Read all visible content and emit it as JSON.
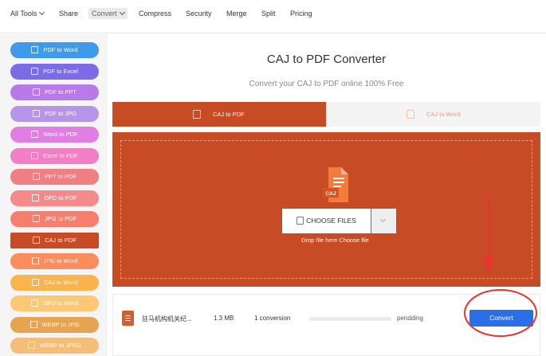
{
  "nav": {
    "all_tools": "All Tools",
    "items": [
      "Share",
      "Convert",
      "Compress",
      "Security",
      "Merge",
      "Split",
      "Pricing"
    ]
  },
  "sidebar": {
    "items": [
      {
        "label": "PDF to Word",
        "color": "#3d9be9"
      },
      {
        "label": "PDF to Excel",
        "color": "#7c6be6"
      },
      {
        "label": "PDF to PPT",
        "color": "#b77ae6"
      },
      {
        "label": "PDF to JPG",
        "color": "#b694e8"
      },
      {
        "label": "Word to PDF",
        "color": "#e07ee3"
      },
      {
        "label": "Excel to PDF",
        "color": "#f07fc4"
      },
      {
        "label": "PPT to PDF",
        "color": "#f07f84"
      },
      {
        "label": "OFD to PDF",
        "color": "#f58a8a"
      },
      {
        "label": "JPG to PDF",
        "color": "#f77d6c"
      },
      {
        "label": "CAJ to PDF",
        "color": "#c74b24"
      },
      {
        "label": "JPG to Word",
        "color": "#f98d5d"
      },
      {
        "label": "CAJ to Word",
        "color": "#fbb44c"
      },
      {
        "label": "OFD to Word",
        "color": "#fcc873"
      },
      {
        "label": "WEBP to JPG",
        "color": "#e6a452"
      },
      {
        "label": "WEBP to JPEG",
        "color": "#f2be78"
      }
    ]
  },
  "main": {
    "title": "CAJ to PDF Converter",
    "subtitle": "Convert your CAJ to PDF online 100% Free",
    "tabs": [
      "CAJ to PDF",
      "CAJ to Word"
    ],
    "file_badge": "CAJ",
    "choose_files": "CHOOSE FILES",
    "drop_hint": "Drop file here Choose file"
  },
  "file_row": {
    "name": "驻马机构机关纪...",
    "size": "1.3 MB",
    "conversions": "1 conversion",
    "progress": 0,
    "status": "pendding",
    "convert_label": "Convert"
  },
  "colors": {
    "accent": "#c74b24",
    "convert_blue": "#2b6fe6",
    "annotation_red": "#e8342e"
  }
}
